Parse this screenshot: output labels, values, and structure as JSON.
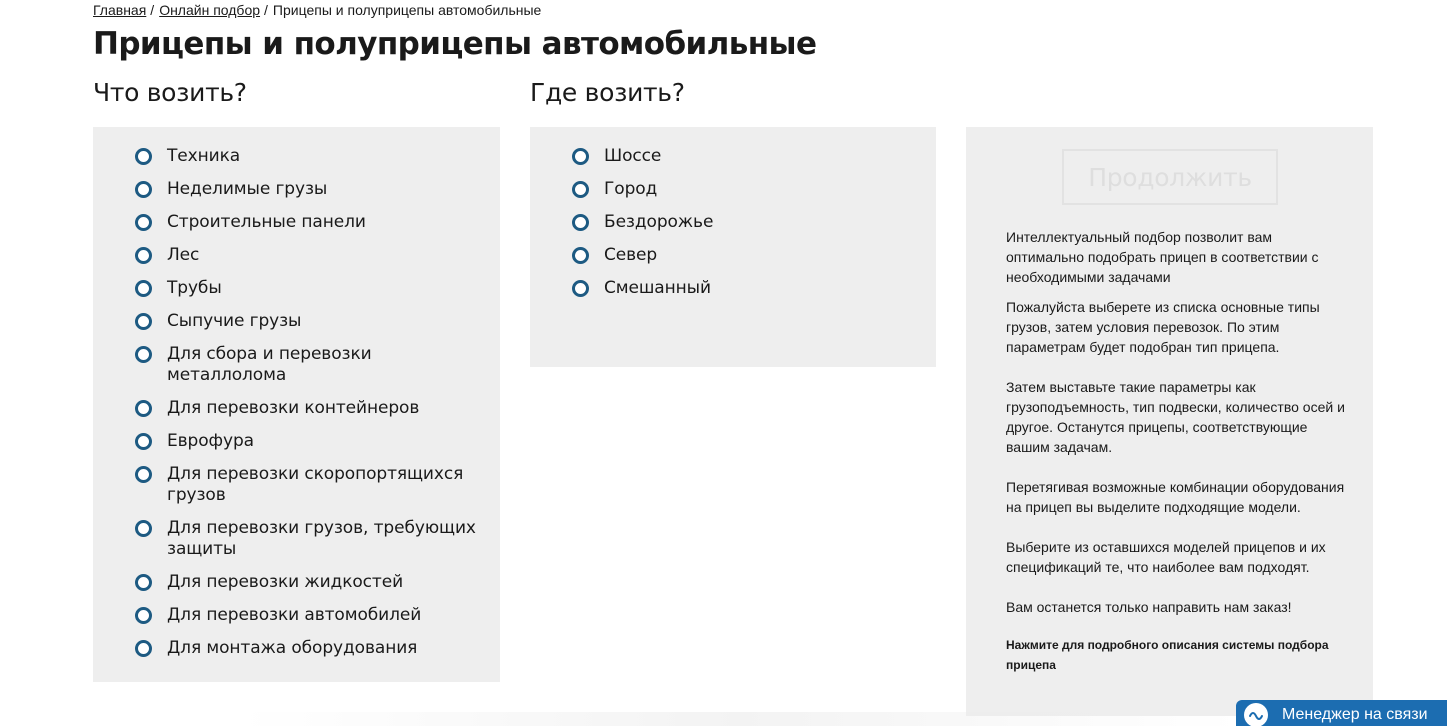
{
  "breadcrumb": {
    "items": [
      {
        "label": "Главная"
      },
      {
        "label": "Онлайн подбор"
      }
    ],
    "current": "Прицепы и полуприцепы автомобильные",
    "separator": "/"
  },
  "page_title": "Прицепы и полуприцепы автомобильные",
  "what": {
    "title": "Что возить?",
    "options": [
      "Техника",
      "Неделимые грузы",
      "Строительные панели",
      "Лес",
      "Трубы",
      "Сыпучие грузы",
      "Для сбора и перевозки металлолома",
      "Для перевозки контейнеров",
      "Еврофура",
      "Для перевозки скоропортящихся грузов",
      "Для перевозки грузов, требующих защиты",
      "Для перевозки жидкостей",
      "Для перевозки автомобилей",
      "Для монтажа оборудования"
    ]
  },
  "where": {
    "title": "Где возить?",
    "options": [
      "Шоссе",
      "Город",
      "Бездорожье",
      "Север",
      "Смешанный"
    ]
  },
  "info": {
    "continue_label": "Продолжить",
    "paragraphs": [
      "Интеллектуальный подбор позволит вам оптимально подобрать прицеп в соответствии с необходимыми задачами",
      "Пожалуйста выберете из списка основные типы грузов, затем условия перевозок. По этим параметрам будет подобран тип прицепа.",
      "Затем выставьте такие параметры как грузоподъемность, тип подвески, количество осей и другое. Останутся прицепы, соответствующие вашим задачам.",
      "Перетягивая возможные комбинации оборудования на прицеп вы выделите подходящие модели.",
      "Выберите из оставшихся моделей прицепов и их спецификаций те, что наиболее вам подходят.",
      "Вам останется только направить нам заказ!"
    ],
    "detail_link": "Нажмите для подробного описания системы подбора прицепа"
  },
  "manager": {
    "label": "Менеджер на связи",
    "icon": "chat-icon"
  },
  "colors": {
    "panel_bg": "#eeeeee",
    "radio_border": "#1d5a82",
    "manager_bg": "#1c6db1",
    "button_disabled": "#e2e2e2"
  }
}
